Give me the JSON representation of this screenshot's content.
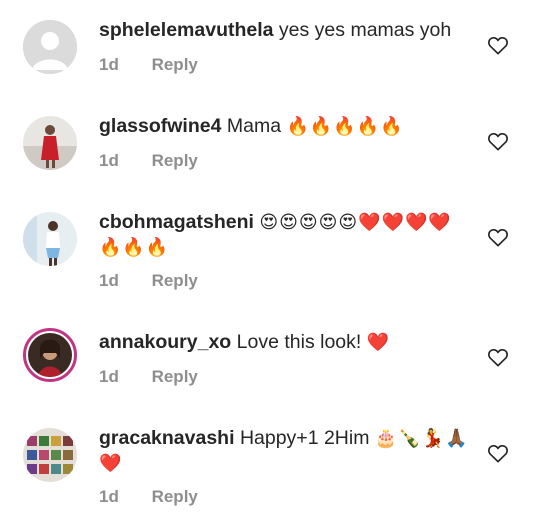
{
  "comments": [
    {
      "username": "sphelelemavuthela",
      "text": "yes yes mamas yoh",
      "emoji": "",
      "time": "1d",
      "reply": "Reply"
    },
    {
      "username": "glassofwine4",
      "text": "Mama",
      "emoji": "🔥🔥🔥🔥🔥",
      "time": "1d",
      "reply": "Reply"
    },
    {
      "username": "cbohmagatsheni",
      "text": "",
      "emoji": "😍😍😍😍😍❤️❤️❤️❤️🔥🔥🔥",
      "time": "1d",
      "reply": "Reply"
    },
    {
      "username": "annakoury_xo",
      "text": "Love this look!",
      "emoji": "❤️",
      "time": "1d",
      "reply": "Reply"
    },
    {
      "username": "gracaknavashi",
      "text": "Happy+1 2Him",
      "emoji": "🎂🍾💃🙏🏾❤️",
      "time": "1d",
      "reply": "Reply"
    }
  ],
  "colors": {
    "primary_text": "#262626",
    "secondary_text": "#8e8e8e",
    "story_ring": "#c13584"
  },
  "icons": {
    "like": "heart-outline-icon"
  }
}
